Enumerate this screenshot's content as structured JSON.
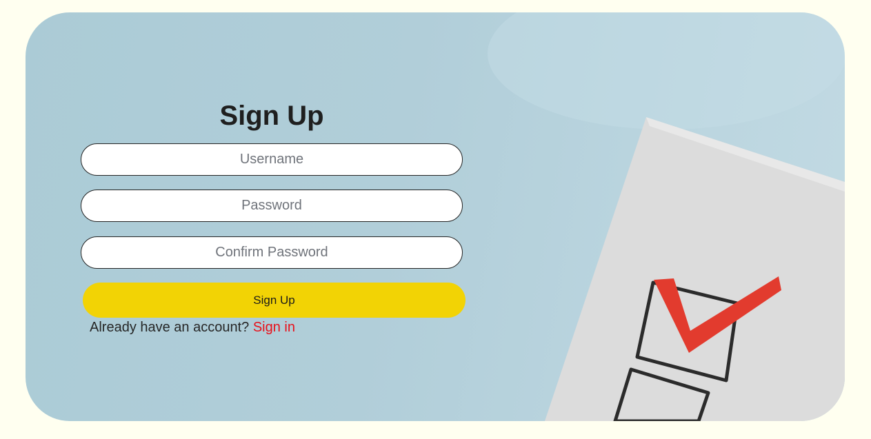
{
  "form": {
    "title": "Sign Up",
    "username_placeholder": "Username",
    "password_placeholder": "Password",
    "confirm_placeholder": "Confirm Password",
    "submit_label": "Sign Up",
    "switch_prompt": "Already have an account?",
    "switch_link": "Sign in"
  },
  "colors": {
    "page_background": "#fffff0",
    "card_background": "#b1ced9",
    "button_yellow": "#f2d305",
    "link_red": "#e8101a",
    "check_red": "#e23b2e"
  },
  "illustration": {
    "icon": "checklist-checkmark-icon"
  }
}
